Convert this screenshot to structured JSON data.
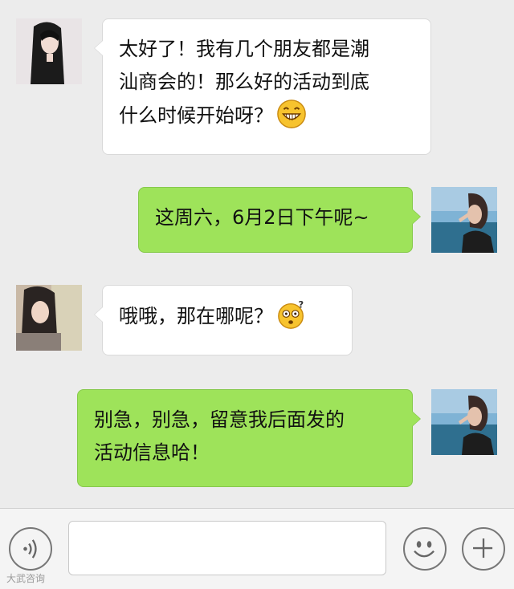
{
  "chat": {
    "messages": [
      {
        "sender": "them",
        "text_lines": [
          "太好了！我有几个朋友都是潮",
          "汕商会的！那么好的活动到底",
          "什么时候开始呀？"
        ],
        "emoji": "grin-emoji"
      },
      {
        "sender": "me",
        "text_lines": [
          "这周六，6月2日下午呢~"
        ]
      },
      {
        "sender": "them",
        "text_lines": [
          "哦哦，那在哪呢？"
        ],
        "emoji": "confused-emoji"
      },
      {
        "sender": "me",
        "text_lines": [
          "别急，别急，留意我后面发的",
          "活动信息哈！"
        ]
      }
    ]
  },
  "input_bar": {
    "placeholder": "",
    "voice_icon": "voice-wave-icon",
    "emoji_icon": "smiley-icon",
    "plus_icon": "plus-icon"
  },
  "watermark": "大武咨询",
  "colors": {
    "background": "#ececec",
    "incoming_bubble": "#ffffff",
    "outgoing_bubble": "#9ee35a"
  }
}
